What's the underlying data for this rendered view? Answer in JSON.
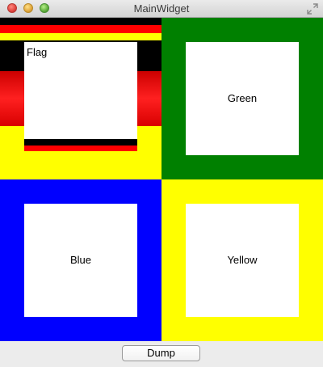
{
  "window": {
    "title": "MainWidget"
  },
  "colors": {
    "flag_black": "#000000",
    "flag_red": "#ff0000",
    "flag_gold": "#ffff00",
    "green": "#008000",
    "blue": "#0000ff",
    "yellow": "#ffff00",
    "card": "#ffffff"
  },
  "panels": {
    "flag": {
      "label": "Flag"
    },
    "green": {
      "label": "Green"
    },
    "blue": {
      "label": "Blue"
    },
    "yellow": {
      "label": "Yellow"
    }
  },
  "toolbar": {
    "dump_label": "Dump"
  }
}
